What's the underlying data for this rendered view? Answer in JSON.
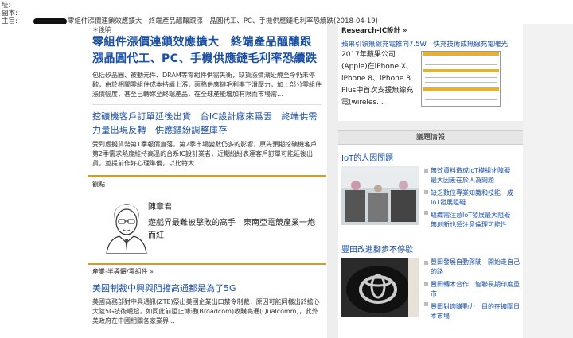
{
  "email_header": {
    "line1": "址:",
    "line2": "副本:",
    "line3_prefix": "主旨:",
    "subject": "零組件漲價連鎖效應擴大　終端產品醞釀跟漲　晶圓代工、PC、手機供應鏈毛利率恐續跌(2018-04-19)"
  },
  "main_article": {
    "tag": "＊後晌",
    "headline": "零組件漲價連鎖效應擴大　終端產品醞釀跟漲晶圓代工、PC、手機供應鏈毛利率恐續跌",
    "body": "包括矽晶圓、被動元件、DRAM等零組件供需失衡，缺貨漲價潮延燒至今仍未停歇，由於相關零組件成本持續上漲，面臨供應鏈毛利率下滑壓力，加上部分零組件漲價幅度，甚至已轉嫁至終端產品，在全球產能增加有限而市場需…"
  },
  "second_article": {
    "headline": "挖礦機客戶訂單延後出貨　台IC設計廠來爲雲　終端供需力量出現反轉　供應鏈紛調整庫存",
    "body": "受到虛擬貨幣第1季報價直落，第2季市場變數仍多的影響，原先預期挖礦機客戶第2季需求熱度維持高溫的台系IC設計業者，近期紛紛表達客戶訂單可能延後出貨，並提前作好心理準備，以比特大…"
  },
  "opinion": {
    "section_label": "觀點",
    "author_name": "陳章君",
    "author_title": "遊戲界最難被擊敗的高手　東南亞電競產業一炮而紅"
  },
  "third_article": {
    "category": "產業-半導體/零組件 »",
    "headline": "美國制裁中興與阻擋高通都是為了5G",
    "body": "美國商務部對中興通訊(ZTE)祭出美國企業出口禁令制裁，原因可能同樣出於擔心大陸5G技術崛起，如同此前阻止博通(Broadcom)收購高通(Qualcomm)，此外美政府在中國相關各家業界..."
  },
  "right": {
    "top_label": "Research-IC設計 »",
    "top_desc": "蘋果引領無線充電推向7.5W　快充技術成無線充電曙光",
    "sub_text": "2017年蘋果公司(Apple)在iPhone X、iPhone 8、iPhone 8 Plus中首次支援無線充電(wireles...",
    "topic_header": "議題情報",
    "iot_title": "IoT的人因問題",
    "iot_links": [
      "無效資料造成IoT模組化障礙　最大因素在於人為問題",
      "缺乏數位專業知識和技能　成IoT發展阻礙",
      "組織需注意IoT發展最大阻礙　無創新也須注意倫理可能性"
    ],
    "toyota_title": "豐田改進腳步不停歇",
    "toyota_links": [
      "豐田發展自動駕駛　開始走自己的路",
      "豐田轉木合作　智聯長期印度重市",
      "豐田對適購動力　目的在擴圍日本市場"
    ]
  },
  "colors": {
    "link_blue": "#1a4fa3",
    "accent_orange": "#d59a2a"
  }
}
